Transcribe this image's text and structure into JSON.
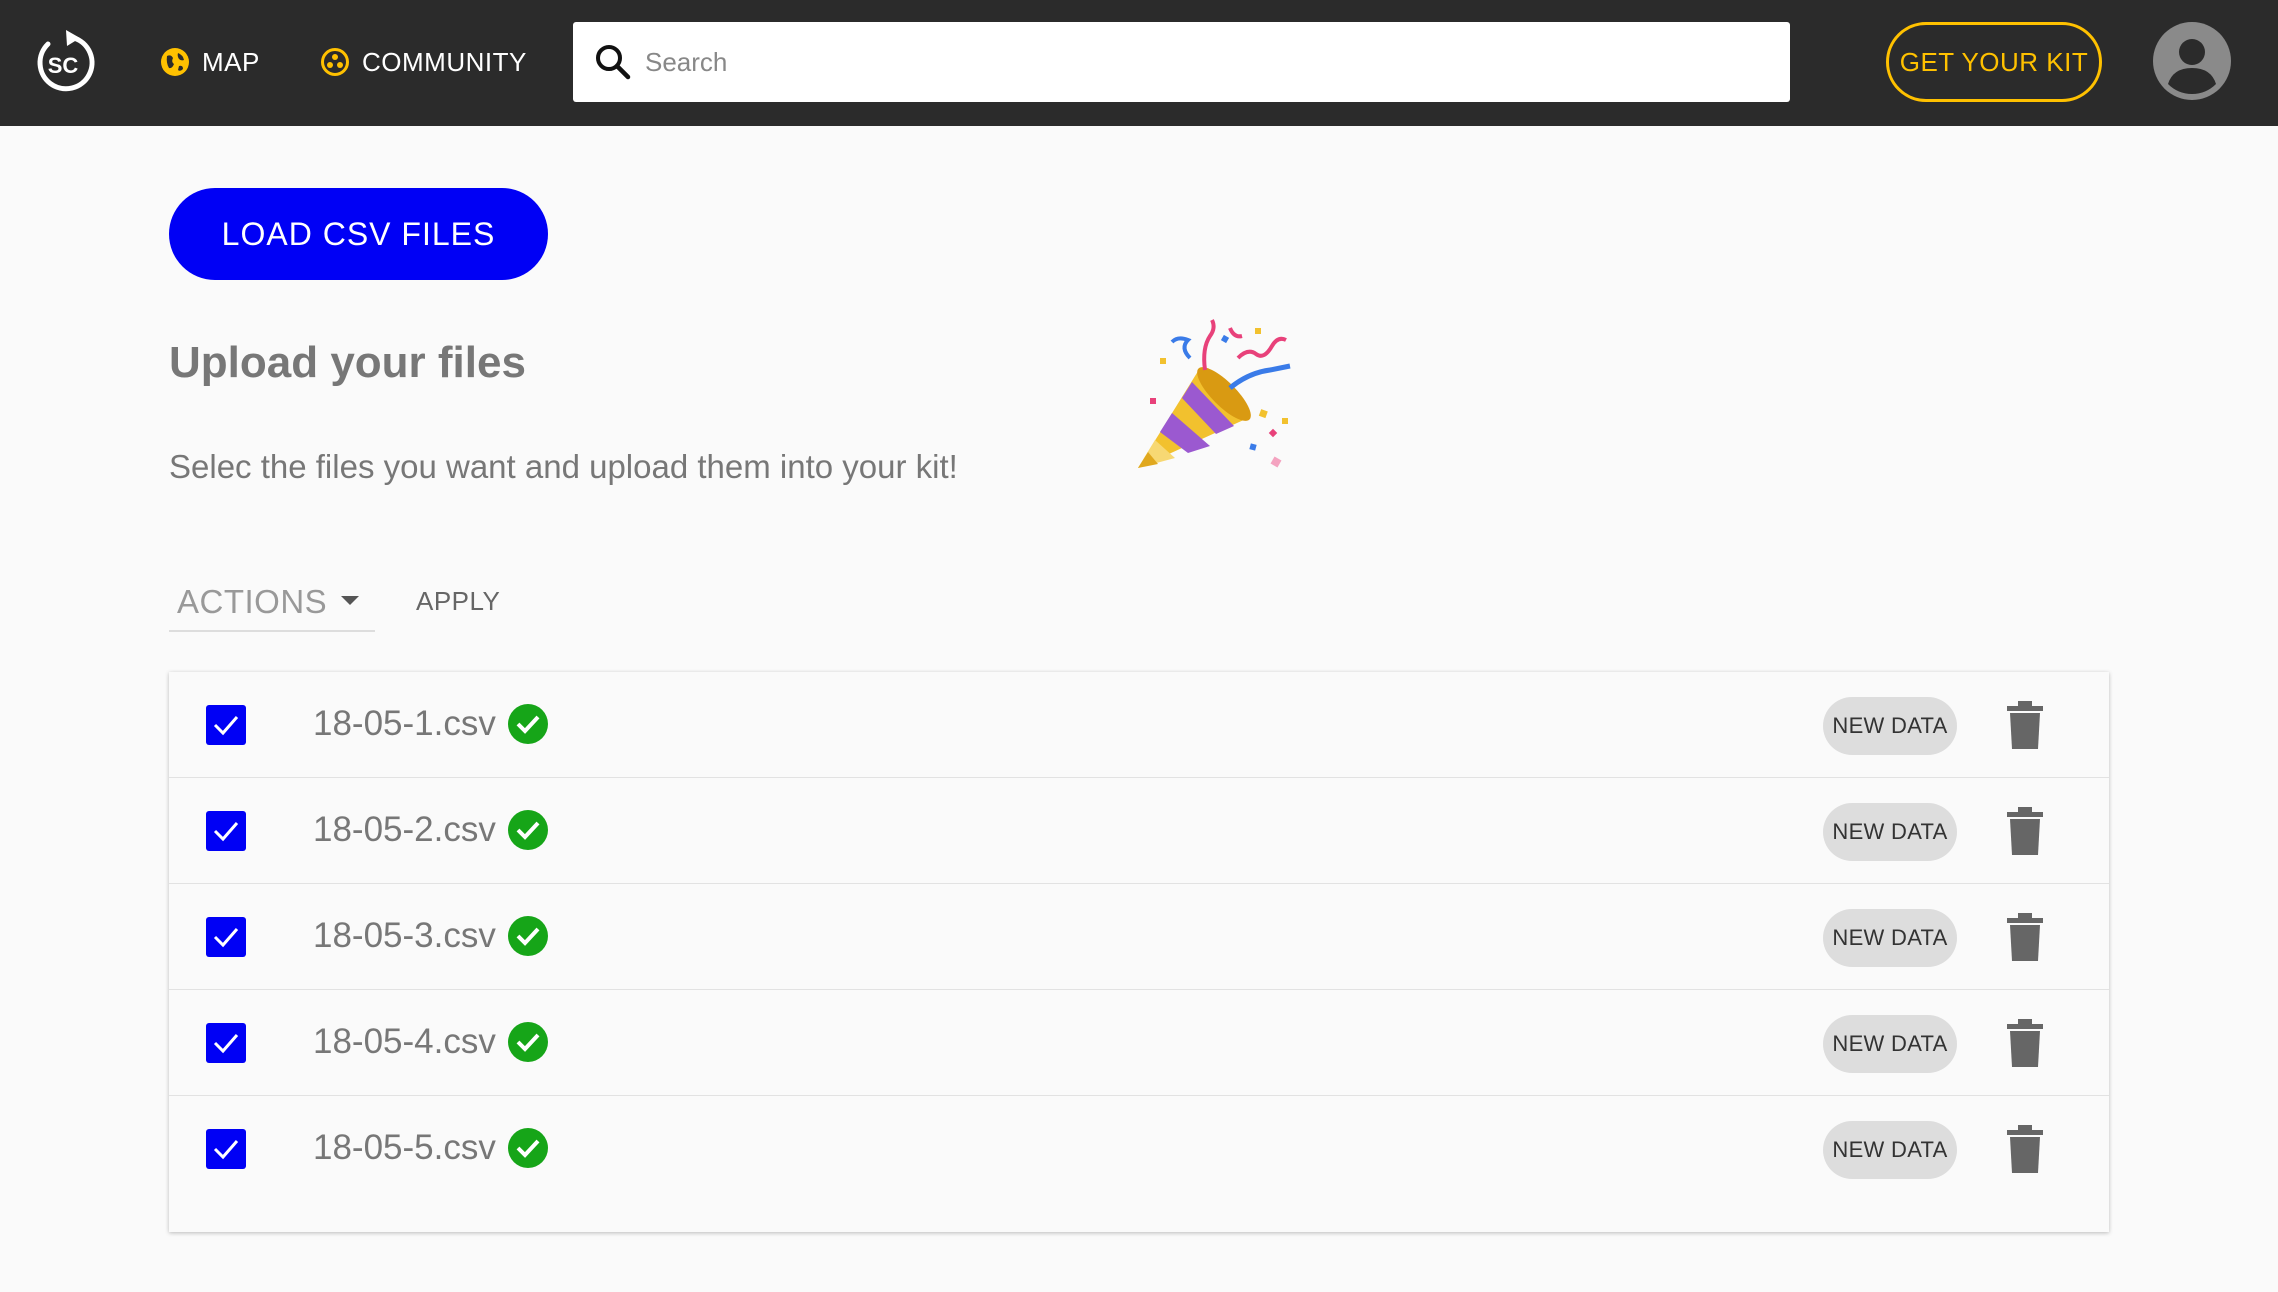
{
  "header": {
    "logo_text": "SC",
    "nav": [
      {
        "label": "MAP",
        "icon": "globe-icon"
      },
      {
        "label": "COMMUNITY",
        "icon": "community-icon"
      }
    ],
    "search": {
      "placeholder": "Search",
      "value": ""
    },
    "kit_button": "GET YOUR KIT",
    "avatar": "account-circle-icon"
  },
  "main": {
    "load_button": "LOAD CSV FILES",
    "title": "Upload your files",
    "subtitle": "Selec the files you want and upload them into your kit!",
    "emoji": "party-popper-icon",
    "actions": {
      "label": "ACTIONS",
      "apply_label": "APPLY"
    },
    "files": [
      {
        "name": "18-05-1.csv",
        "checked": true,
        "status": "ok",
        "badge": "NEW DATA"
      },
      {
        "name": "18-05-2.csv",
        "checked": true,
        "status": "ok",
        "badge": "NEW DATA"
      },
      {
        "name": "18-05-3.csv",
        "checked": true,
        "status": "ok",
        "badge": "NEW DATA"
      },
      {
        "name": "18-05-4.csv",
        "checked": true,
        "status": "ok",
        "badge": "NEW DATA"
      },
      {
        "name": "18-05-5.csv",
        "checked": true,
        "status": "ok",
        "badge": "NEW DATA"
      }
    ]
  },
  "colors": {
    "header_bg": "#2b2b2b",
    "accent_yellow": "#ffc100",
    "primary_blue": "#0000f5",
    "success_green": "#16a518",
    "badge_bg": "#dddddd"
  }
}
